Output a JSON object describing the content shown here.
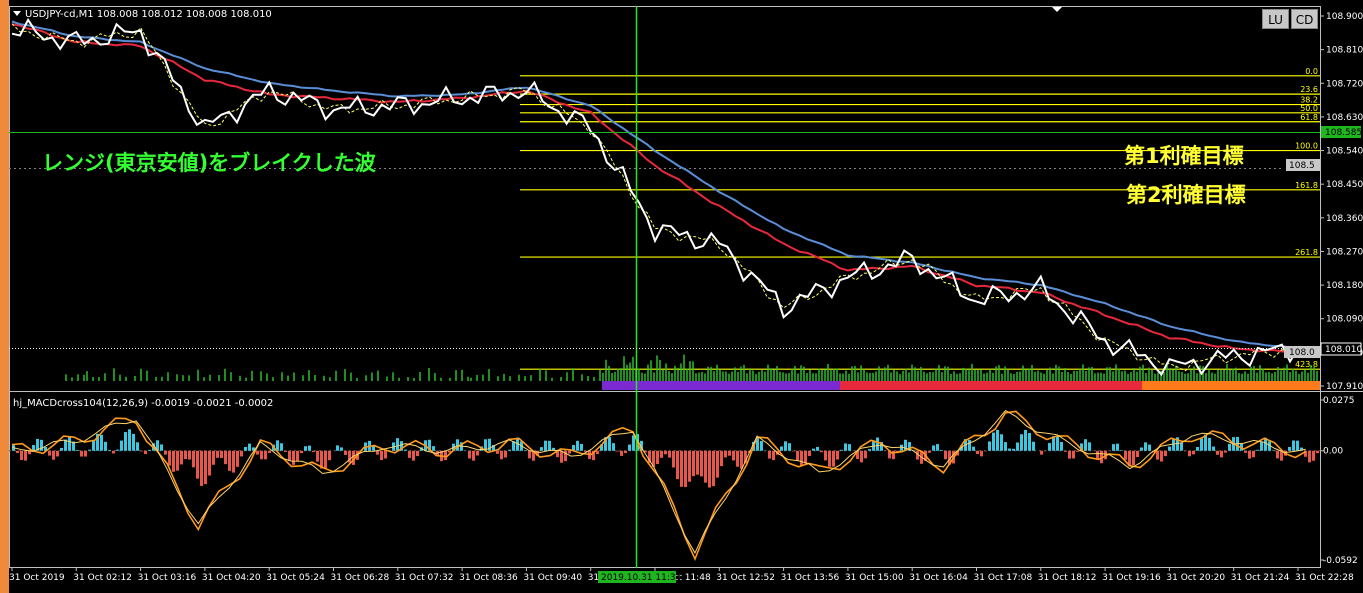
{
  "main_panel": {
    "title": "USDJPY-cd,M1  108.008 108.012 108.008 108.010",
    "y_ticks": [
      "108.900",
      "108.810",
      "108.720",
      "108.630",
      "108.540",
      "108.450",
      "108.360",
      "108.270",
      "108.180",
      "108.090",
      "108.000",
      "107.910"
    ],
    "y_markers": {
      "green": "108.585",
      "gray": "108.5",
      "price_box": "108.0",
      "price_box_right": "108.010"
    },
    "annotation": "レンジ(東京安値)をブレイクした波",
    "targets": [
      "第1利確目標",
      "第2利確目標"
    ],
    "buttons": {
      "lu": "LU",
      "cd": "CD"
    }
  },
  "fibonacci_levels": [
    {
      "label": "0.0",
      "price": 108.74
    },
    {
      "label": "23.6",
      "price": 108.691
    },
    {
      "label": "38.2",
      "price": 108.663
    },
    {
      "label": "50.0",
      "price": 108.641
    },
    {
      "label": "61.8",
      "price": 108.617
    },
    {
      "label": "100.0",
      "price": 108.54
    },
    {
      "label": "161.8",
      "price": 108.435
    },
    {
      "label": "261.8",
      "price": 108.255
    },
    {
      "label": "423.8",
      "price": 107.955
    }
  ],
  "macd_panel": {
    "title": "hj_MACDcross104(12,26,9) -0.0019 -0.0021 -0.0002",
    "y_ticks": [
      "0.0275",
      "0.00",
      "-0.0592"
    ]
  },
  "x_axis": {
    "labels": [
      "31 Oct 2019",
      "31 Oct 02:12",
      "31 Oct 03:16",
      "31 Oct 04:20",
      "31 Oct 05:24",
      "31 Oct 06:28",
      "31 Oct 07:32",
      "31 Oct 08:36",
      "31 Oct 09:40",
      "31 Oct 10:44",
      "31 Oct 11:48",
      "31 Oct 12:52",
      "31 Oct 13:56",
      "31 Oct 15:00",
      "31 Oct 16:04",
      "31 Oct 17:08",
      "31 Oct 18:12",
      "31 Oct 19:16",
      "31 Oct 20:20",
      "31 Oct 21:24",
      "31 Oct 22:28"
    ],
    "cursor_label": "2019.10.31 11:34"
  },
  "chart_data": {
    "type": "line",
    "symbol": "USDJPY-cd",
    "timeframe": "M1",
    "ylim": [
      107.91,
      108.9
    ],
    "x": [
      "31 Oct 2019",
      "31 Oct 02:12",
      "31 Oct 03:16",
      "31 Oct 04:20",
      "31 Oct 05:24",
      "31 Oct 06:28",
      "31 Oct 07:32",
      "31 Oct 08:36",
      "31 Oct 09:40",
      "31 Oct 10:44",
      "31 Oct 11:48",
      "31 Oct 12:52",
      "31 Oct 13:56",
      "31 Oct 15:00",
      "31 Oct 16:04",
      "31 Oct 17:08",
      "31 Oct 18:12",
      "31 Oct 19:16",
      "31 Oct 20:20",
      "31 Oct 21:24",
      "31 Oct 22:28"
    ],
    "series": [
      {
        "values": [
          108.865,
          108.83,
          108.86,
          108.6,
          108.7,
          108.65,
          108.66,
          108.68,
          108.7,
          108.6,
          108.33,
          108.29,
          108.12,
          108.2,
          108.25,
          108.14,
          108.17,
          108.03,
          107.96,
          107.99,
          108.01
        ]
      },
      {
        "values": [
          108.88,
          108.83,
          108.82,
          108.73,
          108.69,
          108.68,
          108.67,
          108.68,
          108.7,
          108.64,
          108.5,
          108.39,
          108.29,
          108.22,
          108.23,
          108.18,
          108.16,
          108.1,
          108.04,
          108.01,
          108.0
        ]
      },
      {
        "values": [
          108.885,
          108.845,
          108.83,
          108.76,
          108.72,
          108.7,
          108.685,
          108.69,
          108.71,
          108.66,
          108.54,
          108.43,
          108.33,
          108.26,
          108.24,
          108.2,
          108.18,
          108.13,
          108.07,
          108.03,
          108.01
        ]
      }
    ],
    "macd_ylim": [
      -0.0592,
      0.0275
    ],
    "macd_values": [
      0.0,
      0.005,
      0.018,
      -0.04,
      0.003,
      -0.012,
      0.003,
      0.0,
      0.004,
      -0.003,
      0.012,
      -0.055,
      0.006,
      -0.012,
      0.005,
      -0.008,
      0.02,
      0.004,
      -0.008,
      0.009,
      0.004,
      -0.002
    ]
  }
}
